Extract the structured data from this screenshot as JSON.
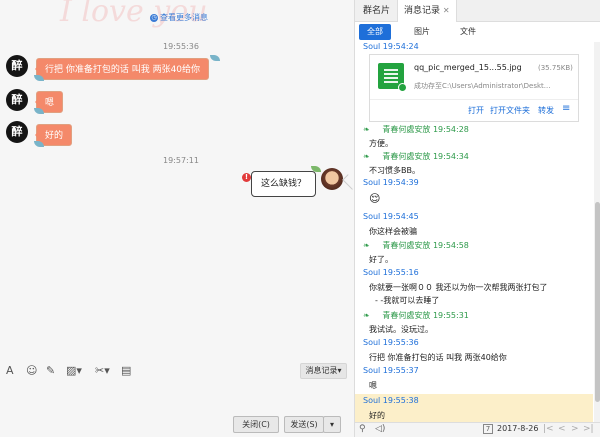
{
  "left": {
    "watermark": "I love you",
    "more_link": "查看更多消息",
    "times": [
      "19:55:36",
      "19:57:11"
    ],
    "incoming": [
      {
        "avatar": "醉",
        "text": "行把    你准备打包的话  叫我    两张40给你"
      },
      {
        "avatar": "醉",
        "text": "嗯"
      },
      {
        "avatar": "醉",
        "text": "好的"
      }
    ],
    "outgoing": {
      "text": "这么缺钱？",
      "error_mark": "!"
    },
    "toolbar": {
      "history_label": "消息记录",
      "history_arrow": "▾"
    },
    "buttons": {
      "close": "关闭(C)",
      "send": "发送(S)",
      "send_menu": "▾"
    }
  },
  "right": {
    "tabs": [
      {
        "label": "群名片"
      },
      {
        "label": "消息记录",
        "close": "✕"
      }
    ],
    "filters": [
      "全部",
      "图片",
      "文件"
    ],
    "file_card": {
      "sender_time": "Soul 19:54:24",
      "name": "qq_pic_merged_15...55.jpg",
      "size": "(35.75KB)",
      "status": "成功存至C:\\Users\\Administrator\\Deskt...",
      "actions": [
        "打开",
        "打开文件夹",
        "转发"
      ],
      "menu_icon": "≡"
    },
    "messages": [
      {
        "sender": "青春何處安放 19:54:28",
        "text": "方便。",
        "mine": false
      },
      {
        "sender": "青春何處安放 19:54:34",
        "text": "不习惯多BB。",
        "mine": false
      },
      {
        "sender": "Soul 19:54:39",
        "text": "😌",
        "mine": true
      },
      {
        "sender": "Soul 19:54:45",
        "text": "你这样会被骗",
        "mine": true
      },
      {
        "sender": "青春何處安放 19:54:58",
        "text": "好了。",
        "mine": false
      },
      {
        "sender": "Soul 19:55:16",
        "text": "你就要一张啊００  我还以为你一次帮我两张打包了",
        "text2": "- -我就可以去睡了",
        "mine": true
      },
      {
        "sender": "青春何處安放 19:55:31",
        "text": "我试试。没玩过。",
        "mine": false
      },
      {
        "sender": "Soul 19:55:36",
        "text": "行把    你准备打包的话  叫我    两张40给你",
        "mine": true
      },
      {
        "sender": "Soul 19:55:37",
        "text": "嗯",
        "mine": true
      },
      {
        "sender": "Soul 19:55:38",
        "text": "好的",
        "mine": true
      }
    ],
    "bottom": {
      "date": "2017-8-26",
      "calendar_day": "7"
    },
    "colors": {
      "accent": "#1e6fd9",
      "incoming_name": "#2e9a4a",
      "bubble": "#f4896a"
    }
  }
}
